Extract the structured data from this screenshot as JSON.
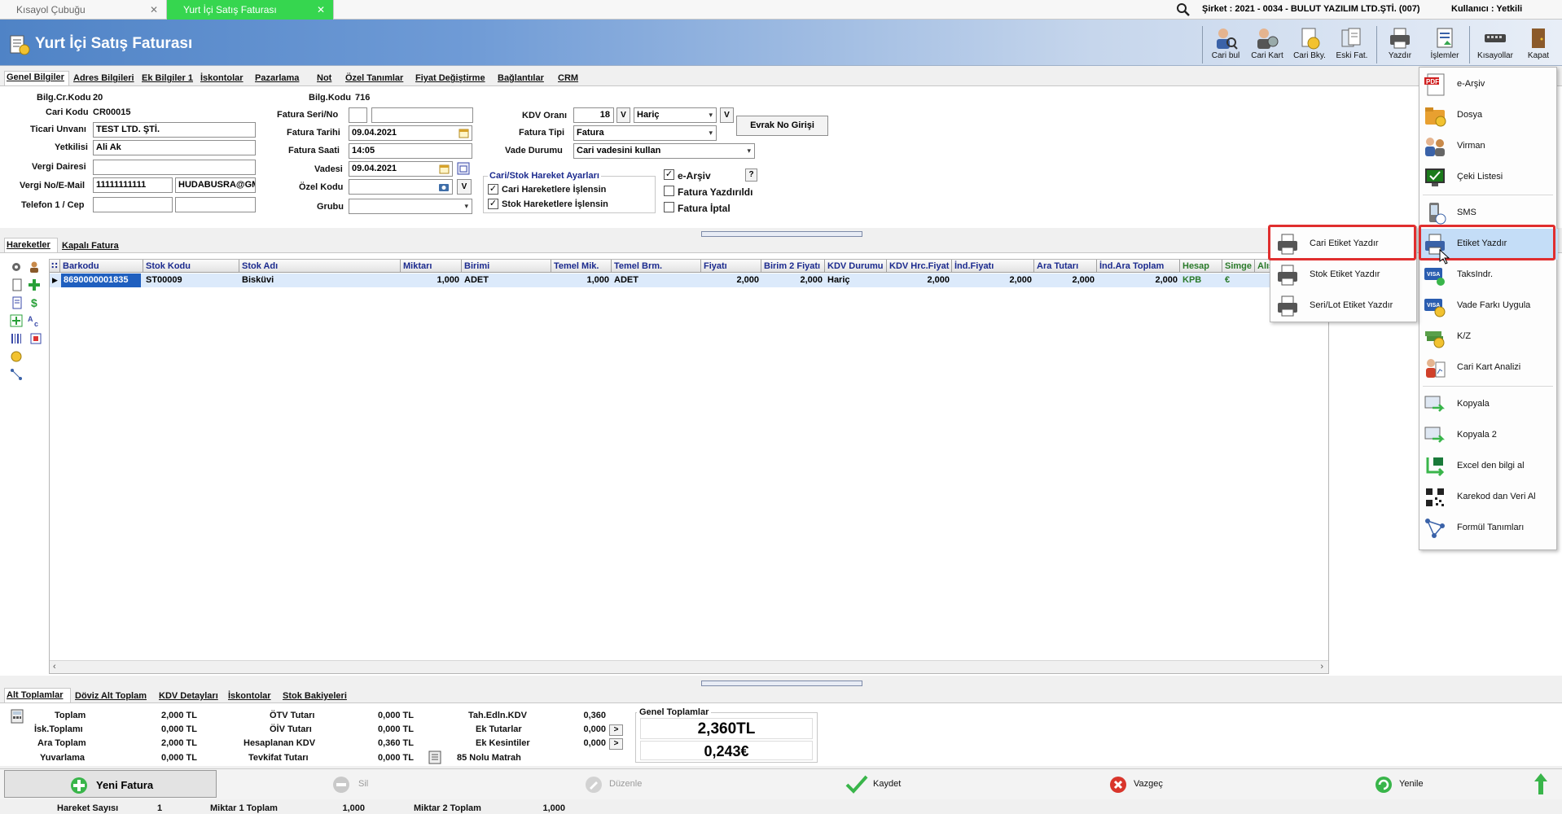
{
  "tabs": [
    {
      "label": "Kısayol Çubuğu",
      "close": "✕"
    },
    {
      "label": "Yurt İçi Satış Faturası",
      "close": "✕"
    }
  ],
  "company": "Şirket : 2021 - 0034 - BULUT YAZILIM LTD.ŞTİ. (007)",
  "user": "Kullanıcı : Yetkili",
  "window_title": "Yurt İçi Satış Faturası",
  "toolbar": {
    "cari_bul": "Cari bul",
    "cari_kart": "Cari Kart",
    "cari_bky": "Cari Bky.",
    "eski_fat": "Eski Fat.",
    "yazdir": "Yazdır",
    "islemler": "İşlemler",
    "kisayollar": "Kısayollar",
    "kapat": "Kapat"
  },
  "section_tabs": [
    "Genel Bilgiler",
    "Adres Bilgileri",
    "Ek Bilgiler 1",
    "İskontolar",
    "Pazarlama",
    "Not",
    "Özel Tanımlar",
    "Fiyat Değiştirme",
    "Bağlantılar",
    "CRM"
  ],
  "form": {
    "bilg_cr_kodu_label": "Bilg.Cr.Kodu",
    "bilg_cr_kodu": "20",
    "cari_kodu_label": "Cari Kodu",
    "cari_kodu": "CR00015",
    "ticari_unvani_label": "Ticari Unvanı",
    "ticari_unvani": "TEST LTD. ŞTİ.",
    "yetkilisi_label": "Yetkilisi",
    "yetkilisi": "Ali Ak",
    "vergi_dairesi_label": "Vergi Dairesi",
    "vergi_dairesi": "",
    "vergi_no_label": "Vergi No/E-Mail",
    "vergi_no": "11111111111",
    "email": "HUDABUSRA@GM",
    "telefon_label": "Telefon 1 / Cep",
    "bilg_kodu_label": "Bilg.Kodu",
    "bilg_kodu": "716",
    "fatura_seri_label": "Fatura Seri/No",
    "fatura_tarihi_label": "Fatura Tarihi",
    "fatura_tarihi": "09.04.2021",
    "fatura_saati_label": "Fatura Saati",
    "fatura_saati": "14:05",
    "vadesi_label": "Vadesi",
    "vadesi": "09.04.2021",
    "ozel_kodu_label": "Özel Kodu",
    "grubu_label": "Grubu",
    "kdv_orani_label": "KDV Oranı",
    "kdv_orani": "18",
    "v": "V",
    "haric": "Hariç",
    "fatura_tipi_label": "Fatura Tipi",
    "fatura_tipi": "Fatura",
    "vade_durumu_label": "Vade Durumu",
    "vade_durumu": "Cari vadesini kullan",
    "evrak_no_btn": "Evrak No Girişi",
    "hareket_ayarlari_title": "Cari/Stok Hareket Ayarları",
    "cari_hareket": "Cari Hareketlere İşlensin",
    "stok_hareket": "Stok Hareketlere İşlensin",
    "e_arsiv": "e-Arşiv",
    "help": "?",
    "fatura_yazdirildi": "Fatura Yazdırıldı",
    "fatura_iptal": "Fatura İptal"
  },
  "grid_tabs": [
    "Hareketler",
    "Kapalı Fatura"
  ],
  "grid": {
    "columns": [
      "Barkodu",
      "Stok Kodu",
      "Stok Adı",
      "Miktarı",
      "Birimi",
      "Temel Mik.",
      "Temel Brm.",
      "Fiyatı",
      "Birim 2 Fiyatı",
      "KDV Durumu",
      "KDV Hrc.Fiyat",
      "İnd.Fiyatı",
      "Ara Tutarı",
      "İnd.Ara Toplam",
      "Hesap",
      "Simge",
      "Alış"
    ],
    "row": {
      "barkod": "8690000001835",
      "stok_kodu": "ST00009",
      "stok_adi": "Bisküvi",
      "miktar": "1,000",
      "birimi": "ADET",
      "temel_mik": "1,000",
      "temel_brm": "ADET",
      "fiyati": "2,000",
      "birim2": "2,000",
      "kdv_durumu": "Hariç",
      "kdv_hrc": "2,000",
      "ind_fiyati": "2,000",
      "ara_tutari": "2,000",
      "ind_ara": "2,000",
      "hesap": "KPB",
      "simge": "€"
    }
  },
  "menu": {
    "items": [
      "e-Arşiv",
      "Dosya",
      "Virman",
      "Çeki Listesi",
      "SMS",
      "Etiket Yazdır",
      "TaksIndr.",
      "Vade Farkı Uygula",
      "K/Z",
      "Cari Kart Analizi",
      "Kopyala",
      "Kopyala 2",
      "Excel den bilgi al",
      "Karekod dan Veri Al",
      "Formül Tanımları"
    ],
    "sub_items": [
      "Cari Etiket Yazdır",
      "Stok Etiket Yazdır",
      "Seri/Lot Etiket Yazdır"
    ]
  },
  "bottom_tabs": [
    "Alt Toplamlar",
    "Döviz Alt Toplam",
    "KDV Detayları",
    "İskontolar",
    "Stok Bakiyeleri"
  ],
  "totals": {
    "toplam_label": "Toplam",
    "toplam": "2,000 TL",
    "isk_label": "İsk.Toplamı",
    "isk": "0,000 TL",
    "ara_label": "Ara Toplam",
    "ara": "2,000 TL",
    "yuv_label": "Yuvarlama",
    "yuv": "0,000 TL",
    "otv_label": "ÖTV Tutarı",
    "otv": "0,000 TL",
    "oiv_label": "ÖİV Tutarı",
    "oiv": "0,000 TL",
    "hkdv_label": "Hesaplanan KDV",
    "hkdv": "0,360 TL",
    "tevk_label": "Tevkifat Tutarı",
    "tevk": "0,000 TL",
    "tah_label": "Tah.Edln.KDV",
    "tah": "0,360",
    "ekt_label": "Ek Tutarlar",
    "ekt": "0,000",
    "ekk_label": "Ek Kesintiler",
    "ekk": "0,000",
    "matrah_label": "85 Nolu Matrah",
    "arrow": ">",
    "genel_label": "Genel Toplamlar",
    "genel_tl": "2,360TL",
    "genel_eur": "0,243€"
  },
  "actions": {
    "yeni": "Yeni Fatura",
    "sil": "Sil",
    "duzenle": "Düzenle",
    "kaydet": "Kaydet",
    "vazgec": "Vazgeç",
    "yenile": "Yenile"
  },
  "status": {
    "hareket_label": "Hareket Sayısı",
    "hareket": "1",
    "m1_label": "Miktar 1 Toplam",
    "m1": "1,000",
    "m2_label": "Miktar 2 Toplam",
    "m2": "1,000"
  },
  "colors": {
    "accent_green": "#36d64f",
    "header_blue": "#4f83c6",
    "highlight": "#c4ddf7",
    "red_box": "#e02e2e"
  }
}
